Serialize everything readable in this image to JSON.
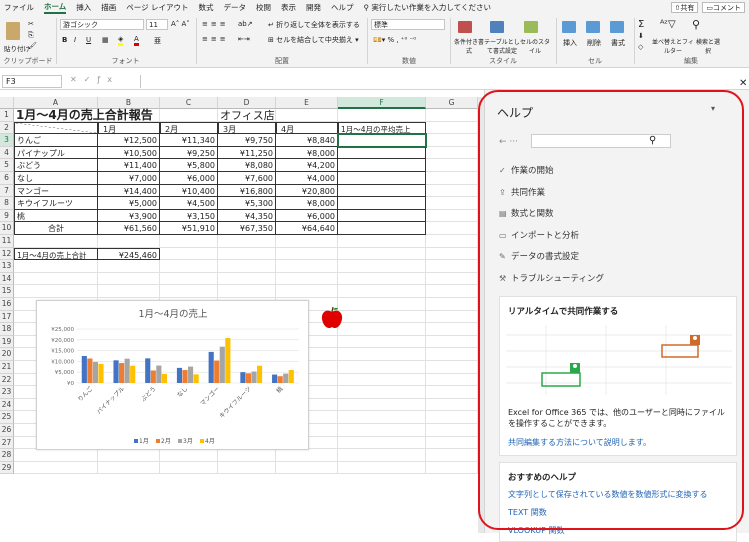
{
  "menu": {
    "items": [
      "ファイル",
      "ホーム",
      "挿入",
      "描画",
      "ページ レイアウト",
      "数式",
      "データ",
      "校閲",
      "表示",
      "開発",
      "ヘルプ"
    ],
    "search": "実行したい作業を入力してください",
    "share": "共有",
    "comment": "コメント"
  },
  "ribbon": {
    "clipboard": {
      "label": "クリップボード",
      "paste": "貼り付け"
    },
    "font": {
      "label": "フォント",
      "name": "游ゴシック",
      "size": "11",
      "bold": "B",
      "italic": "I",
      "underline": "U"
    },
    "alignment": {
      "label": "配置",
      "wrap": "折り返して全体を表示する",
      "merge": "セルを結合して中央揃え"
    },
    "number": {
      "label": "数値",
      "format": "標準"
    },
    "style": {
      "label": "スタイル",
      "conditional": "条件付き書式",
      "table": "テーブルとして書式設定",
      "cellstyle": "セルのスタイル"
    },
    "cells": {
      "label": "セル",
      "insert": "挿入",
      "delete": "削除",
      "format": "書式"
    },
    "edit": {
      "label": "編集",
      "sort": "並べ替えとフィルター",
      "find": "検索と選択"
    }
  },
  "namebox": "F3",
  "columns": [
    "A",
    "B",
    "C",
    "D",
    "E",
    "F",
    "G"
  ],
  "rows": [
    "1",
    "2",
    "3",
    "4",
    "5",
    "6",
    "7",
    "8",
    "9",
    "10",
    "11",
    "12",
    "13",
    "14",
    "15",
    "16",
    "17",
    "18",
    "19",
    "20",
    "21",
    "22",
    "23",
    "24",
    "25",
    "26",
    "27",
    "28",
    "29"
  ],
  "sheet": {
    "title": "1月～4月の売上合計報告",
    "store": "オフィス店",
    "headers": [
      "1月",
      "2月",
      "3月",
      "4月",
      "1月～4月の平均売上"
    ],
    "data": [
      {
        "name": "りんご",
        "v": [
          "¥12,500",
          "¥11,340",
          "¥9,750",
          "¥8,840"
        ]
      },
      {
        "name": "パイナップル",
        "v": [
          "¥10,500",
          "¥9,250",
          "¥11,250",
          "¥8,000"
        ]
      },
      {
        "name": "ぶどう",
        "v": [
          "¥11,400",
          "¥5,800",
          "¥8,080",
          "¥4,200"
        ]
      },
      {
        "name": "なし",
        "v": [
          "¥7,000",
          "¥6,000",
          "¥7,600",
          "¥4,000"
        ]
      },
      {
        "name": "マンゴー",
        "v": [
          "¥14,400",
          "¥10,400",
          "¥16,800",
          "¥20,800"
        ]
      },
      {
        "name": "キウイフルーツ",
        "v": [
          "¥5,000",
          "¥4,500",
          "¥5,300",
          "¥8,000"
        ]
      },
      {
        "name": "桃",
        "v": [
          "¥3,900",
          "¥3,150",
          "¥4,350",
          "¥6,000"
        ]
      }
    ],
    "total_label": "合計",
    "totals": [
      "¥61,560",
      "¥51,910",
      "¥67,350",
      "¥64,640"
    ],
    "grand_label": "1月～4月の売上合計",
    "grand": "¥245,460"
  },
  "chart_data": {
    "type": "bar",
    "title": "1月～4月の売上",
    "categories": [
      "りんご",
      "パイナップル",
      "ぶどう",
      "なし",
      "マンゴー",
      "キウイフルーツ",
      "桃"
    ],
    "series": [
      {
        "name": "1月",
        "color": "#4472c4",
        "values": [
          12500,
          10500,
          11400,
          7000,
          14400,
          5000,
          3900
        ]
      },
      {
        "name": "2月",
        "color": "#ed7d31",
        "values": [
          11340,
          9250,
          5800,
          6000,
          10400,
          4500,
          3150
        ]
      },
      {
        "name": "3月",
        "color": "#a5a5a5",
        "values": [
          9750,
          11250,
          8080,
          7600,
          16800,
          5300,
          4350
        ]
      },
      {
        "name": "4月",
        "color": "#ffc000",
        "values": [
          8840,
          8000,
          4200,
          4000,
          20800,
          8000,
          6000
        ]
      }
    ],
    "ylim": [
      0,
      25000
    ],
    "yticks": [
      "¥0",
      "¥5,000",
      "¥10,000",
      "¥15,000",
      "¥20,000",
      "¥25,000"
    ],
    "legend": "bottom"
  },
  "help": {
    "title": "ヘルプ",
    "nav": [
      {
        "icon": "✓",
        "label": "作業の開始"
      },
      {
        "icon": "⇪",
        "label": "共同作業"
      },
      {
        "icon": "▤",
        "label": "数式と関数"
      },
      {
        "icon": "▭",
        "label": "インポートと分析"
      },
      {
        "icon": "✎",
        "label": "データの書式設定"
      },
      {
        "icon": "⚒",
        "label": "トラブルシューティング"
      }
    ],
    "card1": {
      "title": "リアルタイムで共同作業する",
      "body": "Excel for Office 365 では、他のユーザーと同時にファイルを操作することができます。",
      "link": "共同編集する方法について説明します。"
    },
    "card2": {
      "title": "おすすめのヘルプ",
      "link1": "文字列として保存されている数値を数値形式に変換する",
      "link2": "TEXT 関数",
      "link3": "VLOOKUP 関数"
    }
  }
}
